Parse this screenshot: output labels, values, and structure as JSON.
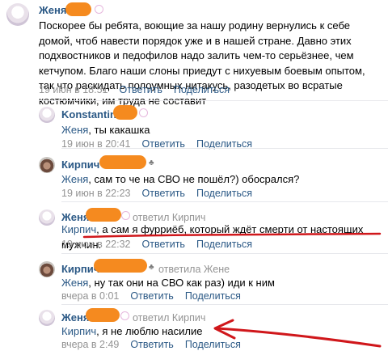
{
  "comments": [
    {
      "author": "Женя",
      "text": "Поскорее бы ребята, воющие за нашу родину вернулись к себе домой, чтоб навести порядок уже и в нашей стране. Давно этих подхвостников и педофилов надо залить чем-то серьёзнее, чем кетчупом. Благо наши слоны приедут с нихуевым боевым опытом, так что раскидать полоумных нитакусь, разодетых во всратые костюмчики, им труда не составит",
      "date": "19 июн в 18:51",
      "reply": "Ответить",
      "share": "Поделиться"
    },
    {
      "author": "Konstantin",
      "addressee": "Женя",
      "text": ", ты какашка",
      "date": "19 июн в 20:41",
      "reply": "Ответить",
      "share": "Поделиться"
    },
    {
      "author": "Кирпич",
      "addressee": "Женя",
      "text": ", сам то че на СВО не пошёл?) обосрался?",
      "date": "19 июн в 22:23",
      "reply": "Ответить",
      "share": "Поделиться"
    },
    {
      "author": "Женя",
      "reply_to": "ответил Кирпич",
      "addressee": "Кирпич",
      "text": ", а сам я фурриёб, который ждёт смерти от настоящих мужчин.",
      "date": "19 июн в 22:32",
      "reply": "Ответить",
      "share": "Поделиться"
    },
    {
      "author": "Кирпич",
      "reply_to": "ответила Жене",
      "addressee": "Женя",
      "text": ", ну так они на СВО как раз) иди к ним",
      "date": "вчера в 0:01",
      "reply": "Ответить",
      "share": "Поделиться"
    },
    {
      "author": "Женя",
      "reply_to": "ответил Кирпич",
      "addressee": "Кирпич",
      "text": ", я не люблю насилие",
      "date": "вчера в 2:49",
      "reply": "Ответить",
      "share": "Поделиться"
    }
  ],
  "colors": {
    "link": "#2a5885",
    "meta": "#939393",
    "redaction": "#f58a1f",
    "annotation": "#d0171b"
  }
}
